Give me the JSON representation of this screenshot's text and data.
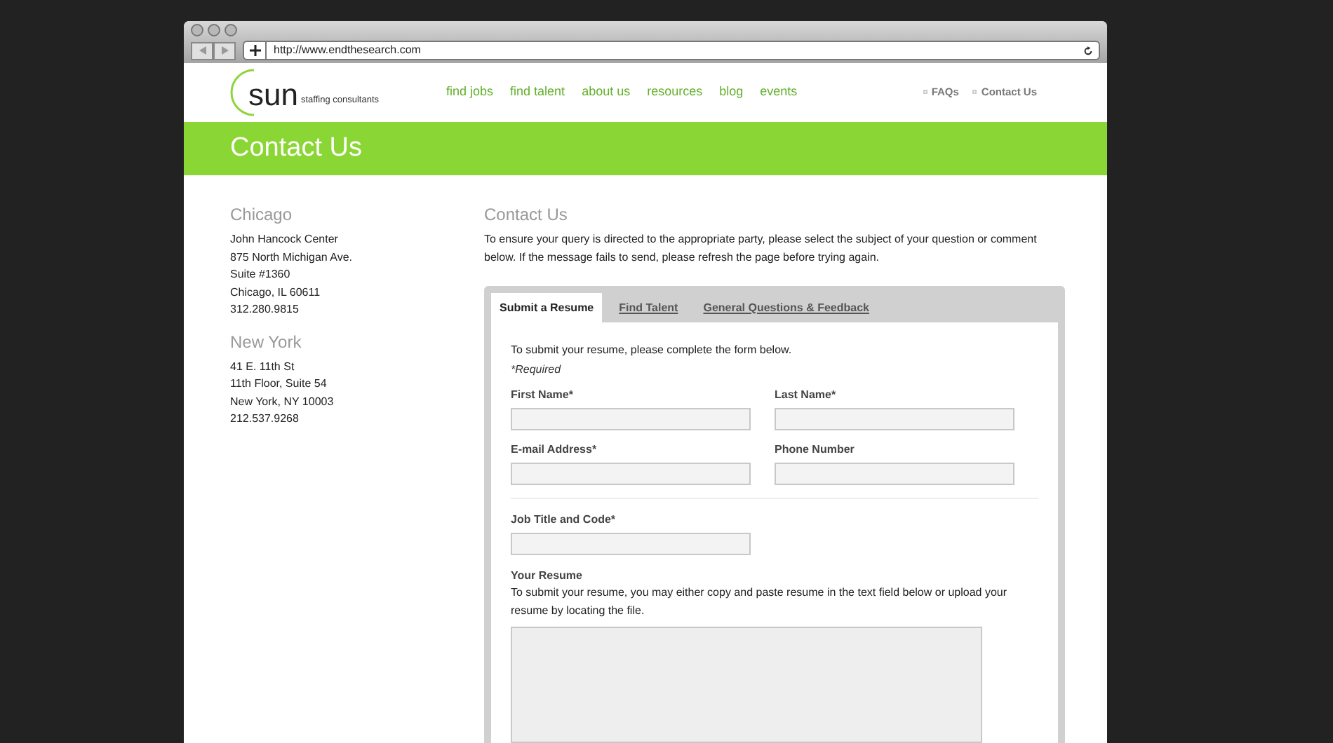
{
  "browser": {
    "url": "http://www.endthesearch.com"
  },
  "logo": {
    "wordmark": "sun",
    "tagline": "staffing consultants"
  },
  "nav": [
    {
      "label": "find jobs"
    },
    {
      "label": "find talent"
    },
    {
      "label": "about us"
    },
    {
      "label": "resources"
    },
    {
      "label": "blog"
    },
    {
      "label": "events"
    }
  ],
  "utility_links": [
    {
      "label": "FAQs"
    },
    {
      "label": "Contact Us"
    }
  ],
  "banner": {
    "title": "Contact Us"
  },
  "offices": [
    {
      "city": "Chicago",
      "lines": [
        "John Hancock Center",
        "875 North Michigan Ave.",
        "Suite #1360",
        "Chicago, IL 60611",
        "312.280.9815"
      ]
    },
    {
      "city": "New York",
      "lines": [
        "41 E. 11th St",
        "11th Floor, Suite 54",
        "New York, NY 10003",
        "212.537.9268"
      ]
    }
  ],
  "contact": {
    "heading": "Contact Us",
    "intro": "To ensure your query is directed to the appropriate party, please select the subject of your question or comment below. If the message fails to send, please refresh the page before trying again."
  },
  "tabs": [
    {
      "label": "Submit a Resume",
      "selected": true
    },
    {
      "label": "Find Talent",
      "selected": false
    },
    {
      "label": "General Questions & Feedback",
      "selected": false
    }
  ],
  "form": {
    "intro": "To submit your resume, please complete the form below.",
    "required_note": "*Required",
    "personal_fields": [
      {
        "label": "First Name*"
      },
      {
        "label": "Last Name*"
      },
      {
        "label": "E-mail Address*"
      },
      {
        "label": "Phone Number"
      }
    ],
    "job_fields": [
      {
        "label": "Job Title and Code*"
      }
    ],
    "resume": {
      "label": "Your Resume",
      "help": "To submit your resume, you may either copy and paste resume in the text field below or upload your resume by locating the file."
    }
  }
}
